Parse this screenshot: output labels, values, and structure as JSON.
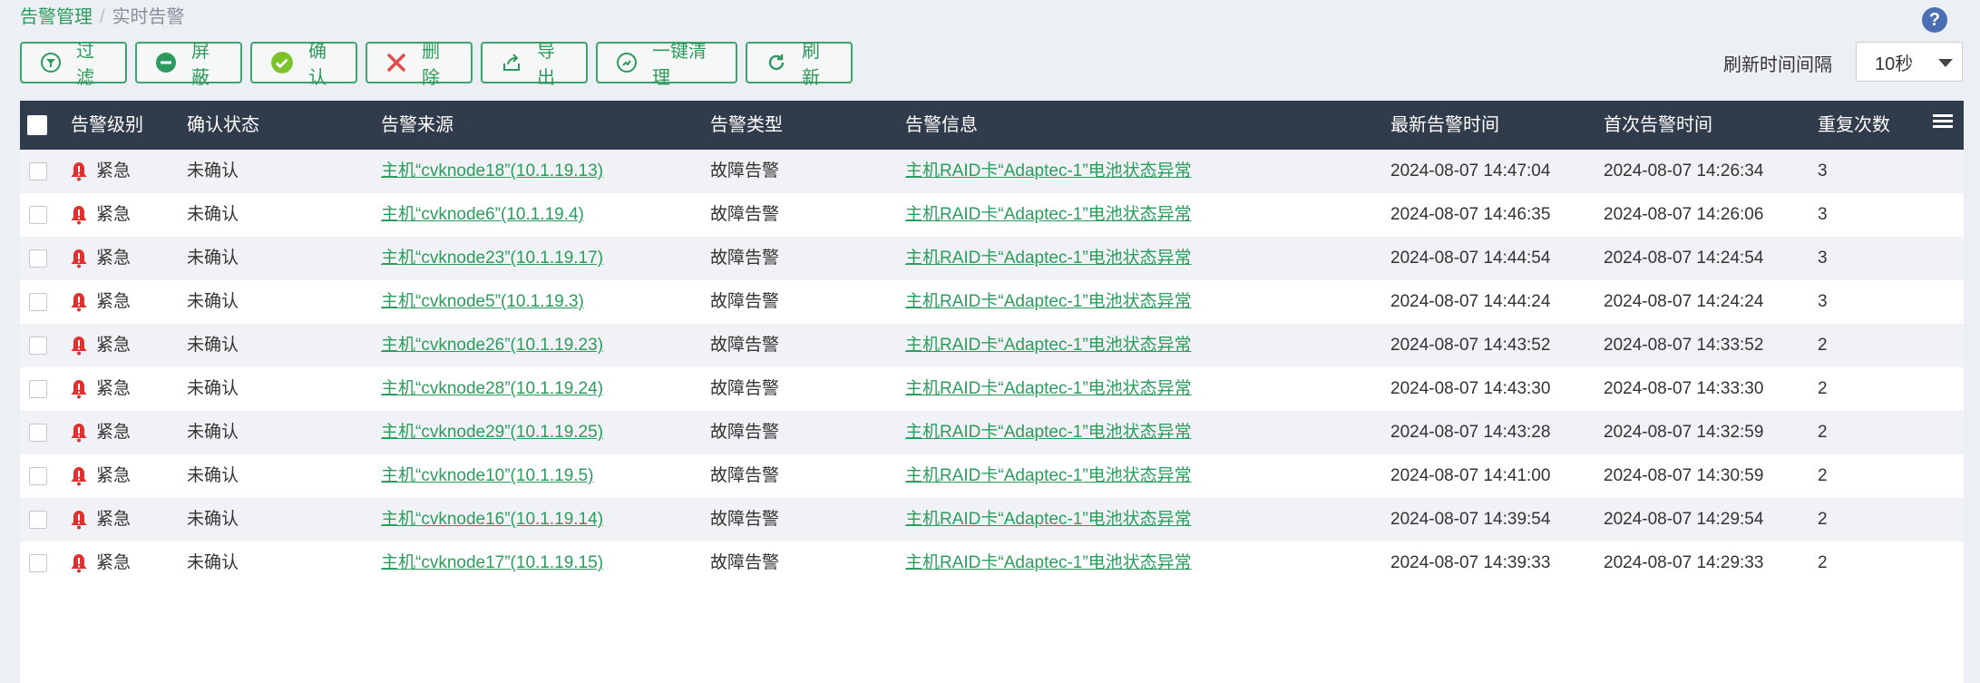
{
  "breadcrumb": {
    "root": "告警管理",
    "separator": "/",
    "current": "实时告警"
  },
  "help_icon": "question-circle-icon",
  "toolbar": [
    {
      "label": "过滤",
      "icon": "filter-icon",
      "name": "filter-button"
    },
    {
      "label": "屏蔽",
      "icon": "block-icon",
      "name": "block-button"
    },
    {
      "label": "确认",
      "icon": "check-circle-icon",
      "name": "confirm-button"
    },
    {
      "label": "删除",
      "icon": "delete-x-icon",
      "name": "delete-button"
    },
    {
      "label": "导出",
      "icon": "export-icon",
      "name": "export-button"
    },
    {
      "label": "一键清理",
      "icon": "cleanup-icon",
      "name": "one-click-clean-button"
    },
    {
      "label": "刷新",
      "icon": "refresh-icon",
      "name": "refresh-button"
    }
  ],
  "refresh": {
    "label": "刷新时间间隔",
    "value": "10秒"
  },
  "table": {
    "columns": [
      "告警级别",
      "确认状态",
      "告警来源",
      "告警类型",
      "告警信息",
      "最新告警时间",
      "首次告警时间",
      "重复次数"
    ],
    "rows": [
      {
        "level": "紧急",
        "status": "未确认",
        "source": "主机“cvknode18”(10.1.19.13)",
        "type": "故障告警",
        "info": "主机RAID卡“Adaptec-1”电池状态异常",
        "latest": "2024-08-07 14:47:04",
        "first": "2024-08-07 14:26:34",
        "count": "3"
      },
      {
        "level": "紧急",
        "status": "未确认",
        "source": "主机“cvknode6”(10.1.19.4)",
        "type": "故障告警",
        "info": "主机RAID卡“Adaptec-1”电池状态异常",
        "latest": "2024-08-07 14:46:35",
        "first": "2024-08-07 14:26:06",
        "count": "3"
      },
      {
        "level": "紧急",
        "status": "未确认",
        "source": "主机“cvknode23”(10.1.19.17)",
        "type": "故障告警",
        "info": "主机RAID卡“Adaptec-1”电池状态异常",
        "latest": "2024-08-07 14:44:54",
        "first": "2024-08-07 14:24:54",
        "count": "3"
      },
      {
        "level": "紧急",
        "status": "未确认",
        "source": "主机“cvknode5”(10.1.19.3)",
        "type": "故障告警",
        "info": "主机RAID卡“Adaptec-1”电池状态异常",
        "latest": "2024-08-07 14:44:24",
        "first": "2024-08-07 14:24:24",
        "count": "3"
      },
      {
        "level": "紧急",
        "status": "未确认",
        "source": "主机“cvknode26”(10.1.19.23)",
        "type": "故障告警",
        "info": "主机RAID卡“Adaptec-1”电池状态异常",
        "latest": "2024-08-07 14:43:52",
        "first": "2024-08-07 14:33:52",
        "count": "2"
      },
      {
        "level": "紧急",
        "status": "未确认",
        "source": "主机“cvknode28”(10.1.19.24)",
        "type": "故障告警",
        "info": "主机RAID卡“Adaptec-1”电池状态异常",
        "latest": "2024-08-07 14:43:30",
        "first": "2024-08-07 14:33:30",
        "count": "2"
      },
      {
        "level": "紧急",
        "status": "未确认",
        "source": "主机“cvknode29”(10.1.19.25)",
        "type": "故障告警",
        "info": "主机RAID卡“Adaptec-1”电池状态异常",
        "latest": "2024-08-07 14:43:28",
        "first": "2024-08-07 14:32:59",
        "count": "2"
      },
      {
        "level": "紧急",
        "status": "未确认",
        "source": "主机“cvknode10”(10.1.19.5)",
        "type": "故障告警",
        "info": "主机RAID卡“Adaptec-1”电池状态异常",
        "latest": "2024-08-07 14:41:00",
        "first": "2024-08-07 14:30:59",
        "count": "2"
      },
      {
        "level": "紧急",
        "status": "未确认",
        "source": "主机“cvknode16”(10.1.19.14)",
        "type": "故障告警",
        "info": "主机RAID卡“Adaptec-1”电池状态异常",
        "latest": "2024-08-07 14:39:54",
        "first": "2024-08-07 14:29:54",
        "count": "2"
      },
      {
        "level": "紧急",
        "status": "未确认",
        "source": "主机“cvknode17”(10.1.19.15)",
        "type": "故障告警",
        "info": "主机RAID卡“Adaptec-1”电池状态异常",
        "latest": "2024-08-07 14:39:33",
        "first": "2024-08-07 14:29:33",
        "count": "2"
      }
    ]
  },
  "colors": {
    "accent": "#2a9d5c",
    "header_bg": "#303b4b",
    "critical": "#e03131"
  }
}
